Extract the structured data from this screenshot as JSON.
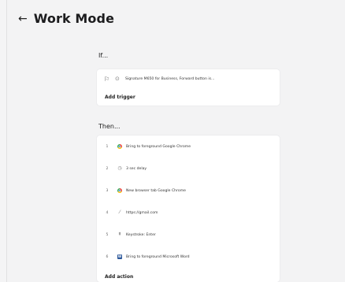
{
  "header": {
    "back_icon": "←",
    "title": "Work Mode"
  },
  "if_section": {
    "label": "If...",
    "trigger": {
      "text": "Signature M650 for Business, Forward button is..."
    },
    "add_label": "Add trigger"
  },
  "then_section": {
    "label": "Then...",
    "actions": [
      {
        "num": "1",
        "icon": "chrome-icon",
        "label": "Bring to foreground Google Chrome"
      },
      {
        "num": "2",
        "icon": "clock-icon",
        "label": "3 sec delay"
      },
      {
        "num": "3",
        "icon": "chrome-icon",
        "label": "New browser tab Google Chrome"
      },
      {
        "num": "4",
        "icon": "link-icon",
        "label": "https://gmail.com"
      },
      {
        "num": "5",
        "icon": "keystroke-icon",
        "label": "Keystroke: Enter"
      },
      {
        "num": "6",
        "icon": "word-icon",
        "label": "Bring to foreground Microsoft Word"
      }
    ],
    "add_label": "Add action"
  },
  "colors": {
    "background": "#f3f3f4",
    "card": "#ffffff",
    "word_blue": "#2b579a"
  }
}
